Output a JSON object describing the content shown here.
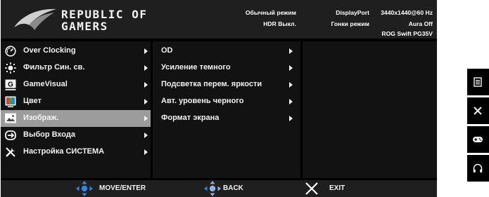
{
  "brand": {
    "line1": "REPUBLIC OF",
    "line2": "GAMERS"
  },
  "status": {
    "mode": "Обычный режим",
    "hdr": "HDR Выкл.",
    "input": "DisplayPort",
    "gamevisual": "Гонки режим",
    "resolution": "3440x1440@60 Hz",
    "aura": "Aura Off",
    "model": "ROG Swift PG35V"
  },
  "main_menu": {
    "items": [
      {
        "label": "Over Clocking",
        "icon": "speedometer-icon"
      },
      {
        "label": "Фильтр Син. св.",
        "icon": "blue-light-icon"
      },
      {
        "label": "GameVisual",
        "icon": "gamevisual-icon"
      },
      {
        "label": "Цвет",
        "icon": "color-icon"
      },
      {
        "label": "Изображ.",
        "icon": "image-icon",
        "selected": true
      },
      {
        "label": "Выбор Входа",
        "icon": "input-select-icon"
      },
      {
        "label": "Настройка СИСТЕМА",
        "icon": "system-setup-icon"
      }
    ]
  },
  "sub_menu": {
    "items": [
      {
        "label": "OD"
      },
      {
        "label": "Усиление темного"
      },
      {
        "label": "Подсветка перем. яркости"
      },
      {
        "label": "Авт. уровень черного"
      },
      {
        "label": "Формат экрана"
      }
    ]
  },
  "footer": {
    "move_enter": "MOVE/ENTER",
    "back": "BACK",
    "exit": "EXIT"
  },
  "hotkeys": [
    {
      "icon": "menu-icon"
    },
    {
      "icon": "close-icon"
    },
    {
      "icon": "gamepad-icon"
    },
    {
      "icon": "headphones-icon"
    }
  ],
  "colors": {
    "selected_row": "#9c9c9c",
    "dpad_blue": "#2f86e6",
    "exit_x": "#ffffff"
  }
}
